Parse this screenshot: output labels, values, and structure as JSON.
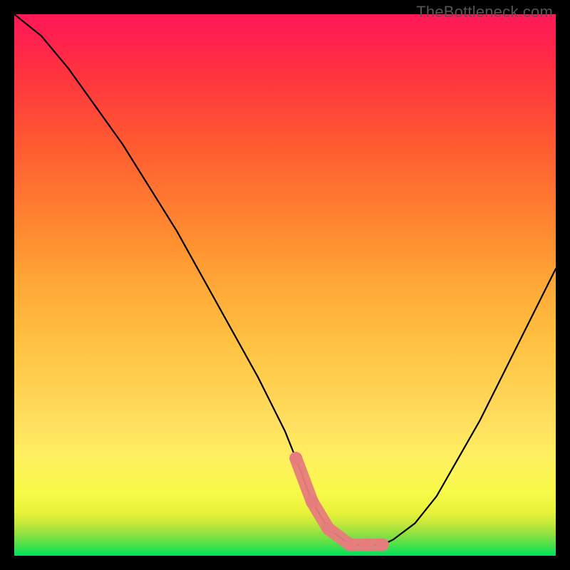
{
  "watermark": "TheBottleneck.com",
  "colors": {
    "frame": "#000000",
    "curve": "#000000",
    "trough_marker": "#e77c7c",
    "gradient_top": "#ff1858",
    "gradient_mid": "#ffe060",
    "gradient_bottom": "#00e05a"
  },
  "chart_data": {
    "type": "line",
    "title": "",
    "xlabel": "",
    "ylabel": "",
    "xlim": [
      0,
      100
    ],
    "ylim": [
      0,
      100
    ],
    "annotations": [
      "TheBottleneck.com"
    ],
    "series": [
      {
        "name": "bottleneck-curve",
        "x": [
          0,
          5,
          10,
          15,
          20,
          25,
          30,
          35,
          40,
          45,
          50,
          52,
          55,
          58,
          62,
          65,
          68,
          70,
          74,
          78,
          82,
          86,
          90,
          94,
          98,
          100
        ],
        "y": [
          100,
          96,
          90,
          83,
          76,
          68,
          60,
          51,
          42,
          33,
          23,
          18,
          10,
          5,
          2,
          2,
          2,
          3,
          6,
          11,
          18,
          25,
          33,
          41,
          49,
          53
        ]
      }
    ],
    "trough_marker": {
      "x": [
        52,
        55,
        58,
        62,
        65,
        68
      ],
      "y": [
        18,
        10,
        5,
        2,
        2,
        2
      ]
    }
  }
}
